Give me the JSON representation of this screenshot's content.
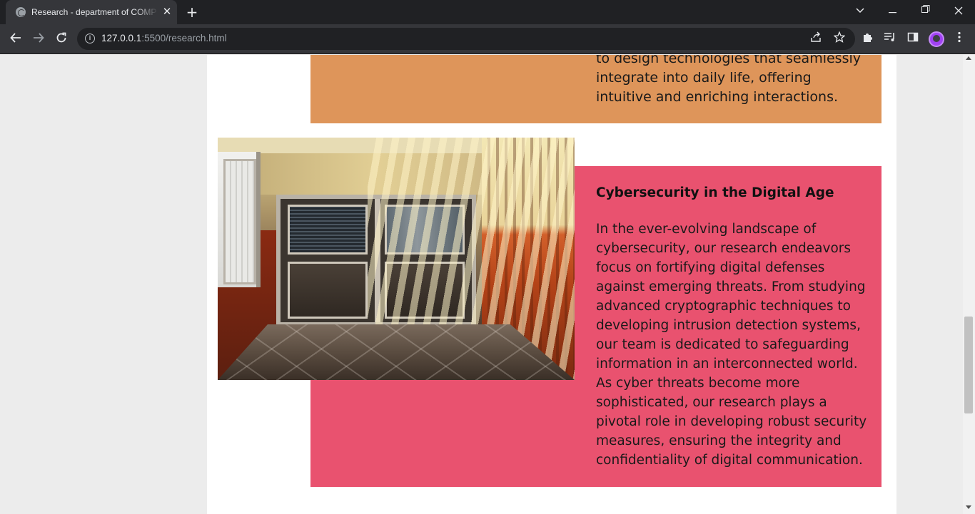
{
  "browser": {
    "tab_title": "Research - department of COMP",
    "tab_close": "✕",
    "new_tab": "+",
    "url_host": "127.0.0.1",
    "url_rest": ":5500/research.html",
    "icons": {
      "favicon": "globe-icon",
      "back": "arrow-left-icon",
      "forward": "arrow-right-icon",
      "reload": "reload-icon",
      "info": "info-icon",
      "share": "share-icon",
      "bookmark": "star-icon",
      "extensions": "puzzle-icon",
      "media": "media-control-icon",
      "side_panel": "side-panel-icon",
      "profile": "avatar",
      "menu": "kebab-menu-icon"
    }
  },
  "page": {
    "top_panel": {
      "color": "#de955a",
      "text": "to design technologies that seamlessly integrate into daily life, offering intuitive and enriching interactions."
    },
    "cyber_panel": {
      "color": "#e9526f",
      "title": "Cybersecurity in the Digital Age",
      "body": "In the ever-evolving landscape of cybersecurity, our research endeavors focus on fortifying digital defenses against emerging threats. From studying advanced cryptographic techniques to developing intrusion detection systems, our team is dedicated to safeguarding information in an interconnected world. As cyber threats become more sophisticated, our research plays a pivotal role in developing robust security measures, ensuring the integrity and confidentiality of digital communication."
    }
  }
}
